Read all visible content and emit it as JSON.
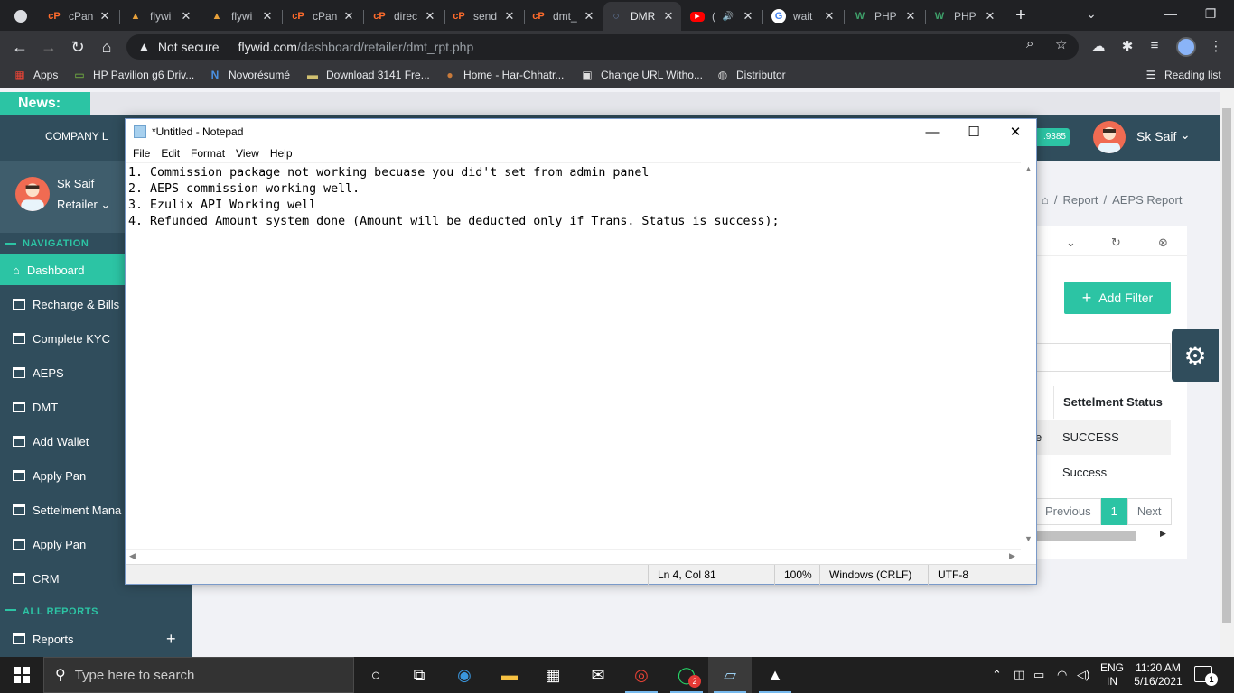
{
  "browser": {
    "tabs": [
      {
        "title": "",
        "icon": "circle-icon"
      },
      {
        "title": "cPan",
        "icon": "cpanel-icon"
      },
      {
        "title": "flywi",
        "icon": "flywid-icon"
      },
      {
        "title": "flywi",
        "icon": "flywid-icon"
      },
      {
        "title": "cPan",
        "icon": "cpanel-icon"
      },
      {
        "title": "direc",
        "icon": "cpanel-icon"
      },
      {
        "title": "send",
        "icon": "cpanel-icon"
      },
      {
        "title": "dmt_",
        "icon": "cpanel-icon"
      },
      {
        "title": "DMR",
        "icon": "page-icon",
        "active": true
      },
      {
        "title": "(",
        "icon": "youtube-icon"
      },
      {
        "title": "wait",
        "icon": "google-icon"
      },
      {
        "title": "PHP",
        "icon": "php-icon"
      },
      {
        "title": "PHP",
        "icon": "php-icon"
      }
    ],
    "address": {
      "security": "Not secure",
      "host": "flywid.com",
      "path": "/dashboard/retailer/dmt_rpt.php"
    },
    "bookmarks": [
      {
        "label": "Apps"
      },
      {
        "label": "HP Pavilion g6 Driv..."
      },
      {
        "label": "Novorésumé"
      },
      {
        "label": "Download 3141 Fre..."
      },
      {
        "label": "Home - Har-Chhatr..."
      },
      {
        "label": "Change URL Witho..."
      },
      {
        "label": "Distributor"
      }
    ],
    "reading_list": "Reading list"
  },
  "webpage": {
    "news_label": "News:",
    "logo_alt": "COMPANY L",
    "wallet_fragment": ".9385",
    "username": "Sk Saif",
    "sidebar": {
      "user_name": "Sk Saif",
      "user_role": "Retailer",
      "nav_heading": "NAVIGATION",
      "items": [
        {
          "label": "Dashboard"
        },
        {
          "label": "Recharge & Bills"
        },
        {
          "label": "Complete KYC"
        },
        {
          "label": "AEPS"
        },
        {
          "label": "DMT"
        },
        {
          "label": "Add Wallet"
        },
        {
          "label": "Apply Pan"
        },
        {
          "label": "Settelment Mana"
        },
        {
          "label": "Apply Pan"
        },
        {
          "label": "CRM"
        }
      ],
      "reports_heading": "ALL REPORTS",
      "reports_item": "Reports"
    },
    "breadcrumb": {
      "report": "Report",
      "current": "AEPS Report"
    },
    "add_filter": "Add Filter",
    "table": {
      "header": "Settelment Status",
      "row1_fragment": "e",
      "rows": [
        "SUCCESS",
        "Success"
      ]
    },
    "pager": {
      "prev": "Previous",
      "current": "1",
      "next": "Next"
    }
  },
  "notepad": {
    "title": "*Untitled - Notepad",
    "menu": [
      "File",
      "Edit",
      "Format",
      "View",
      "Help"
    ],
    "lines": [
      "1. Commission package not working becuase you did't set from admin panel",
      "2. AEPS commission working well.",
      "3. Ezulix API Working well",
      "4. Refunded Amount system done (Amount will be deducted only if Trans. Status is success);"
    ],
    "status": {
      "position": "Ln 4, Col 81",
      "zoom": "100%",
      "line_ending": "Windows (CRLF)",
      "encoding": "UTF-8"
    }
  },
  "taskbar": {
    "search_placeholder": "Type here to search",
    "whatsapp_badge": "2",
    "lang_top": "ENG",
    "lang_bottom": "IN",
    "time": "11:20 AM",
    "date": "5/16/2021",
    "notif_count": "1"
  },
  "colors": {
    "accent": "#2cc4a4",
    "sidebar": "#304d5c",
    "chrome_dark": "#202124"
  }
}
